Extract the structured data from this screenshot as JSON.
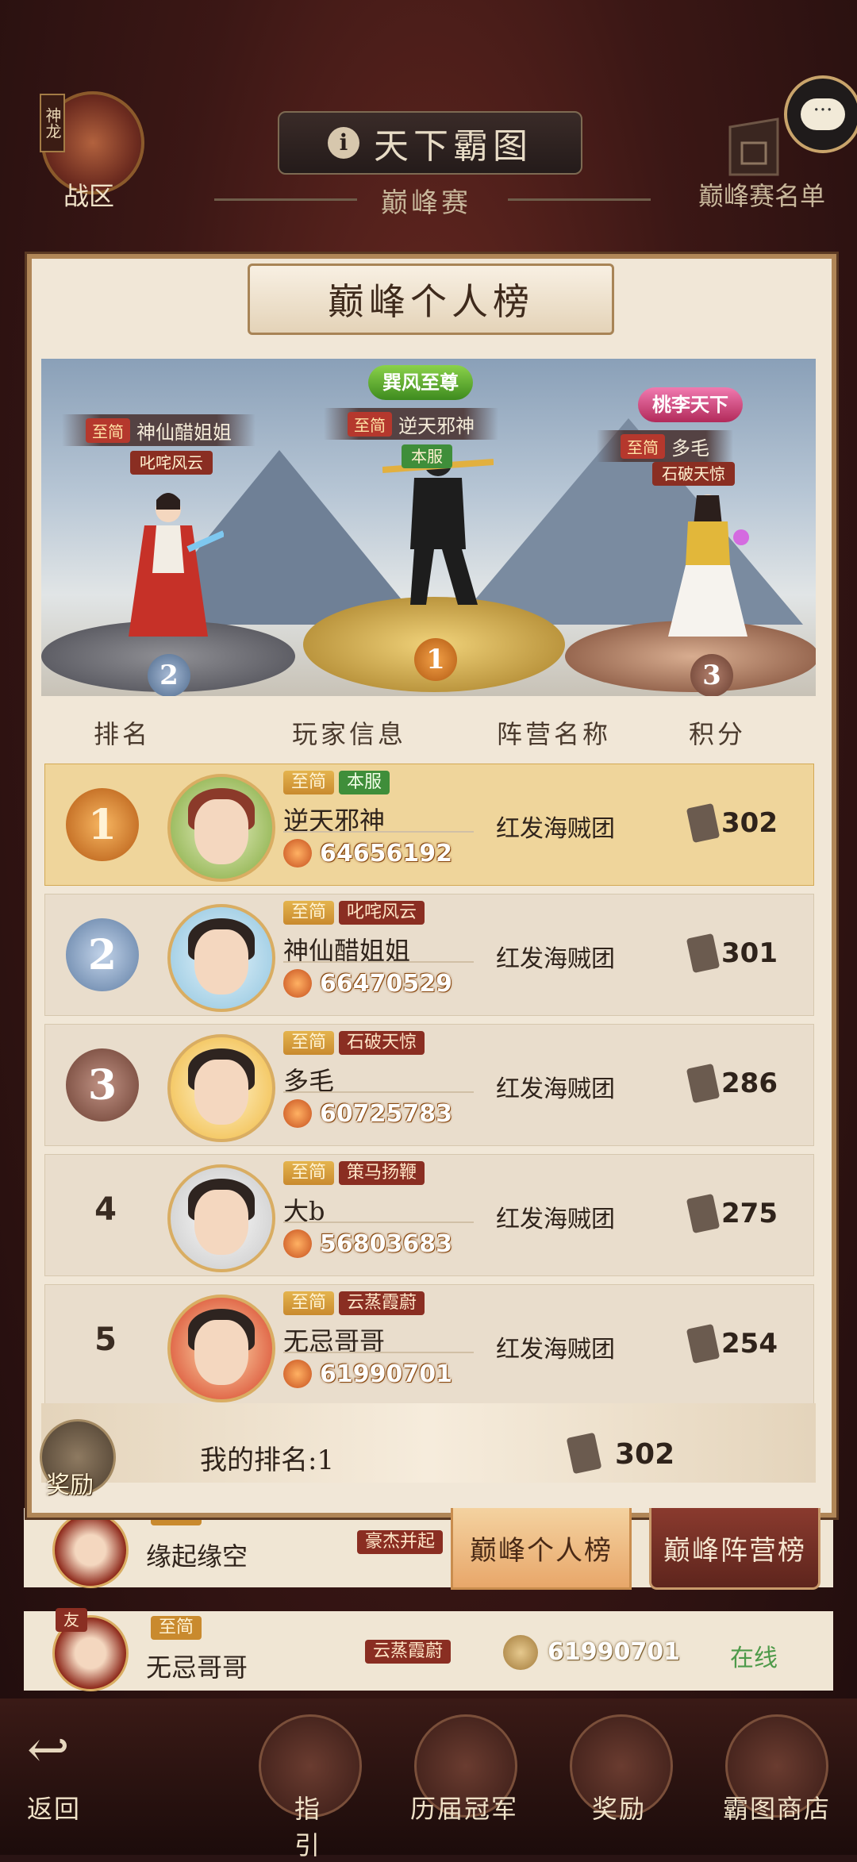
{
  "header": {
    "zone_tag": "神龙",
    "zone_label": "战区",
    "title": "天下霸图",
    "info_icon": "i",
    "subtitle": "巅峰赛",
    "rank_list_label": "巅峰赛名单",
    "chat_icon": "···"
  },
  "panel": {
    "title": "巅峰个人榜"
  },
  "podium": {
    "first": {
      "title_badge": "巽风至尊",
      "zone": "至简",
      "name": "逆天邪神",
      "server": "本服",
      "rank": "1"
    },
    "second": {
      "zone": "至简",
      "name": "神仙醋姐姐",
      "server": "叱咤风云",
      "rank": "2"
    },
    "third": {
      "title_badge": "桃李天下",
      "zone": "至简",
      "name": "多毛",
      "server": "石破天惊",
      "rank": "3"
    }
  },
  "table": {
    "headers": [
      "排名",
      "玩家信息",
      "阵营名称",
      "积分"
    ],
    "rows": [
      {
        "rank": "1",
        "zone": "至简",
        "server": "本服",
        "name": "逆天邪神",
        "power": "64656192",
        "camp": "红发海贼团",
        "score": "302"
      },
      {
        "rank": "2",
        "zone": "至简",
        "server": "叱咤风云",
        "name": "神仙醋姐姐",
        "power": "66470529",
        "camp": "红发海贼团",
        "score": "301"
      },
      {
        "rank": "3",
        "zone": "至简",
        "server": "石破天惊",
        "name": "多毛",
        "power": "60725783",
        "camp": "红发海贼团",
        "score": "286"
      },
      {
        "rank": "4",
        "zone": "至简",
        "server": "策马扬鞭",
        "name": "大b",
        "power": "56803683",
        "camp": "红发海贼团",
        "score": "275"
      },
      {
        "rank": "5",
        "zone": "至简",
        "server": "云蒸霞蔚",
        "name": "无忌哥哥",
        "power": "61990701",
        "camp": "红发海贼团",
        "score": "254"
      }
    ]
  },
  "my_rank": {
    "reward_label": "奖励",
    "text": "我的排名:1",
    "score": "302"
  },
  "tabs": {
    "personal": "巅峰个人榜",
    "camp": "巅峰阵营榜"
  },
  "background_rows": [
    {
      "zone": "至简",
      "name": "缘起缘空",
      "server": "豪杰并起"
    },
    {
      "badge": "友",
      "zone": "至简",
      "name": "无忌哥哥",
      "server": "云蒸霞蔚",
      "power": "61990701",
      "status": "在线"
    }
  ],
  "bottom_nav": {
    "back": "返回",
    "guide": "指引",
    "champions": "历届冠军",
    "rewards": "奖励",
    "shop": "霸图商店"
  },
  "colors": {
    "panel_bg": "#f1e7d7",
    "first_row_bg": "#efd59b",
    "online_green": "#4e9a4a",
    "zone_chip_red": "#b5382d"
  }
}
